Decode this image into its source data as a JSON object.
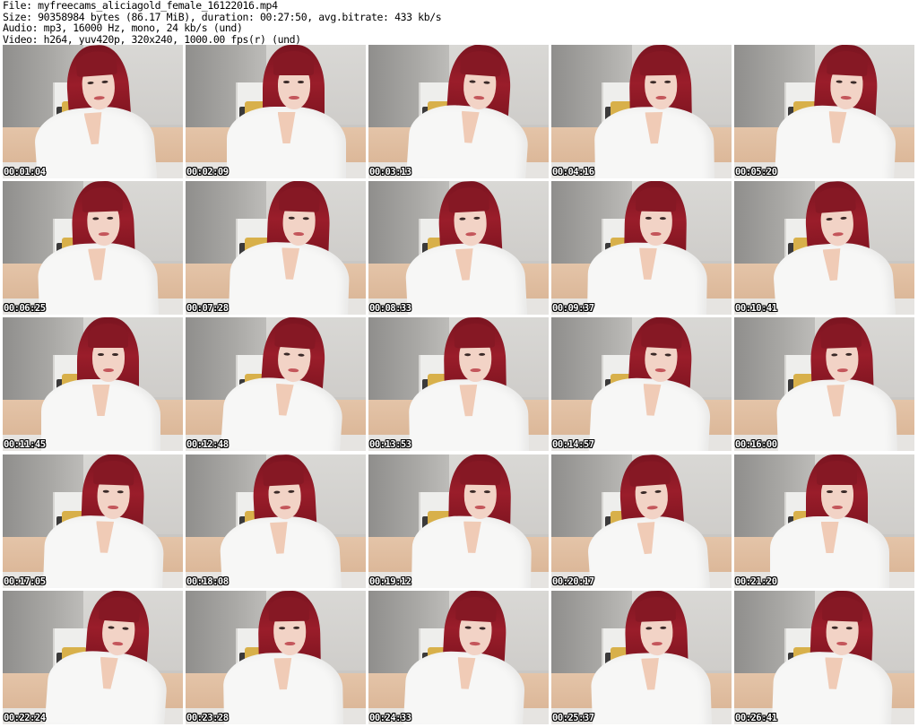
{
  "header": {
    "lines": [
      "File: myfreecams_aliciagold_female_16122016.mp4",
      "Size: 90358984 bytes (86.17 MiB), duration: 00:27:50, avg.bitrate: 433 kb/s",
      "Audio: mp3, 16000 Hz, mono, 24 kb/s (und)",
      "Video: h264, yuv420p, 320x240, 1000.00 fps(r) (und)"
    ]
  },
  "thumbnails": [
    "00:01:04",
    "00:02:09",
    "00:03:13",
    "00:04:16",
    "00:05:20",
    "00:06:25",
    "00:07:28",
    "00:08:33",
    "00:09:37",
    "00:10:41",
    "00:11:45",
    "00:12:48",
    "00:13:53",
    "00:14:57",
    "00:16:00",
    "00:17:05",
    "00:18:08",
    "00:19:12",
    "00:20:17",
    "00:21:20",
    "00:22:24",
    "00:23:28",
    "00:24:33",
    "00:25:37",
    "00:26:41"
  ]
}
